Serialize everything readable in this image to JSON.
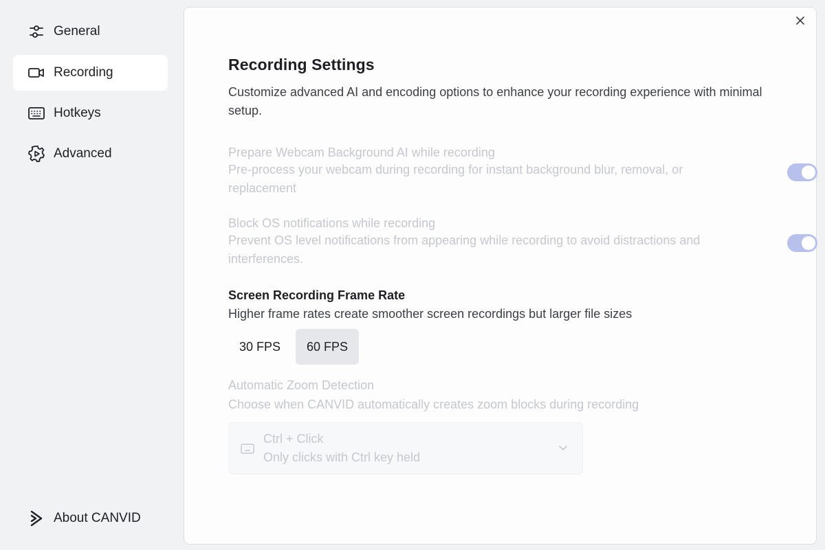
{
  "sidebar": {
    "items": [
      {
        "label": "General",
        "icon": "sliders-icon",
        "active": false
      },
      {
        "label": "Recording",
        "icon": "video-camera-icon",
        "active": true
      },
      {
        "label": "Hotkeys",
        "icon": "keyboard-icon",
        "active": false
      },
      {
        "label": "Advanced",
        "icon": "gear-icon",
        "active": false
      }
    ],
    "about": {
      "label": "About CANVID",
      "icon": "canvid-logo-icon"
    }
  },
  "main": {
    "title": "Recording Settings",
    "description": "Customize advanced AI and encoding options to enhance your recording experience with minimal setup.",
    "settings": [
      {
        "title": "Prepare Webcam Background AI while recording",
        "description": "Pre-process your webcam during recording for instant background blur, removal, or replacement",
        "enabled": true,
        "disabled": true
      },
      {
        "title": "Block OS notifications while recording",
        "description": "Prevent OS level notifications from appearing while recording to avoid distractions and interferences.",
        "enabled": true,
        "disabled": true
      }
    ],
    "frame_rate": {
      "title": "Screen Recording Frame Rate",
      "description": "Higher frame rates create smoother screen recordings but larger file sizes",
      "options": [
        "30 FPS",
        "60 FPS"
      ],
      "selected": "60 FPS"
    },
    "zoom": {
      "title": "Automatic Zoom Detection",
      "description": "Choose when CANVID automatically creates zoom blocks during recording",
      "selected_label": "Ctrl + Click",
      "selected_sublabel": "Only clicks with Ctrl key held",
      "disabled": true
    }
  },
  "colors": {
    "accent_toggle": "#b8c1ec",
    "disabled_text": "#c5c8cf",
    "selected_bg": "#e6e7ea"
  }
}
